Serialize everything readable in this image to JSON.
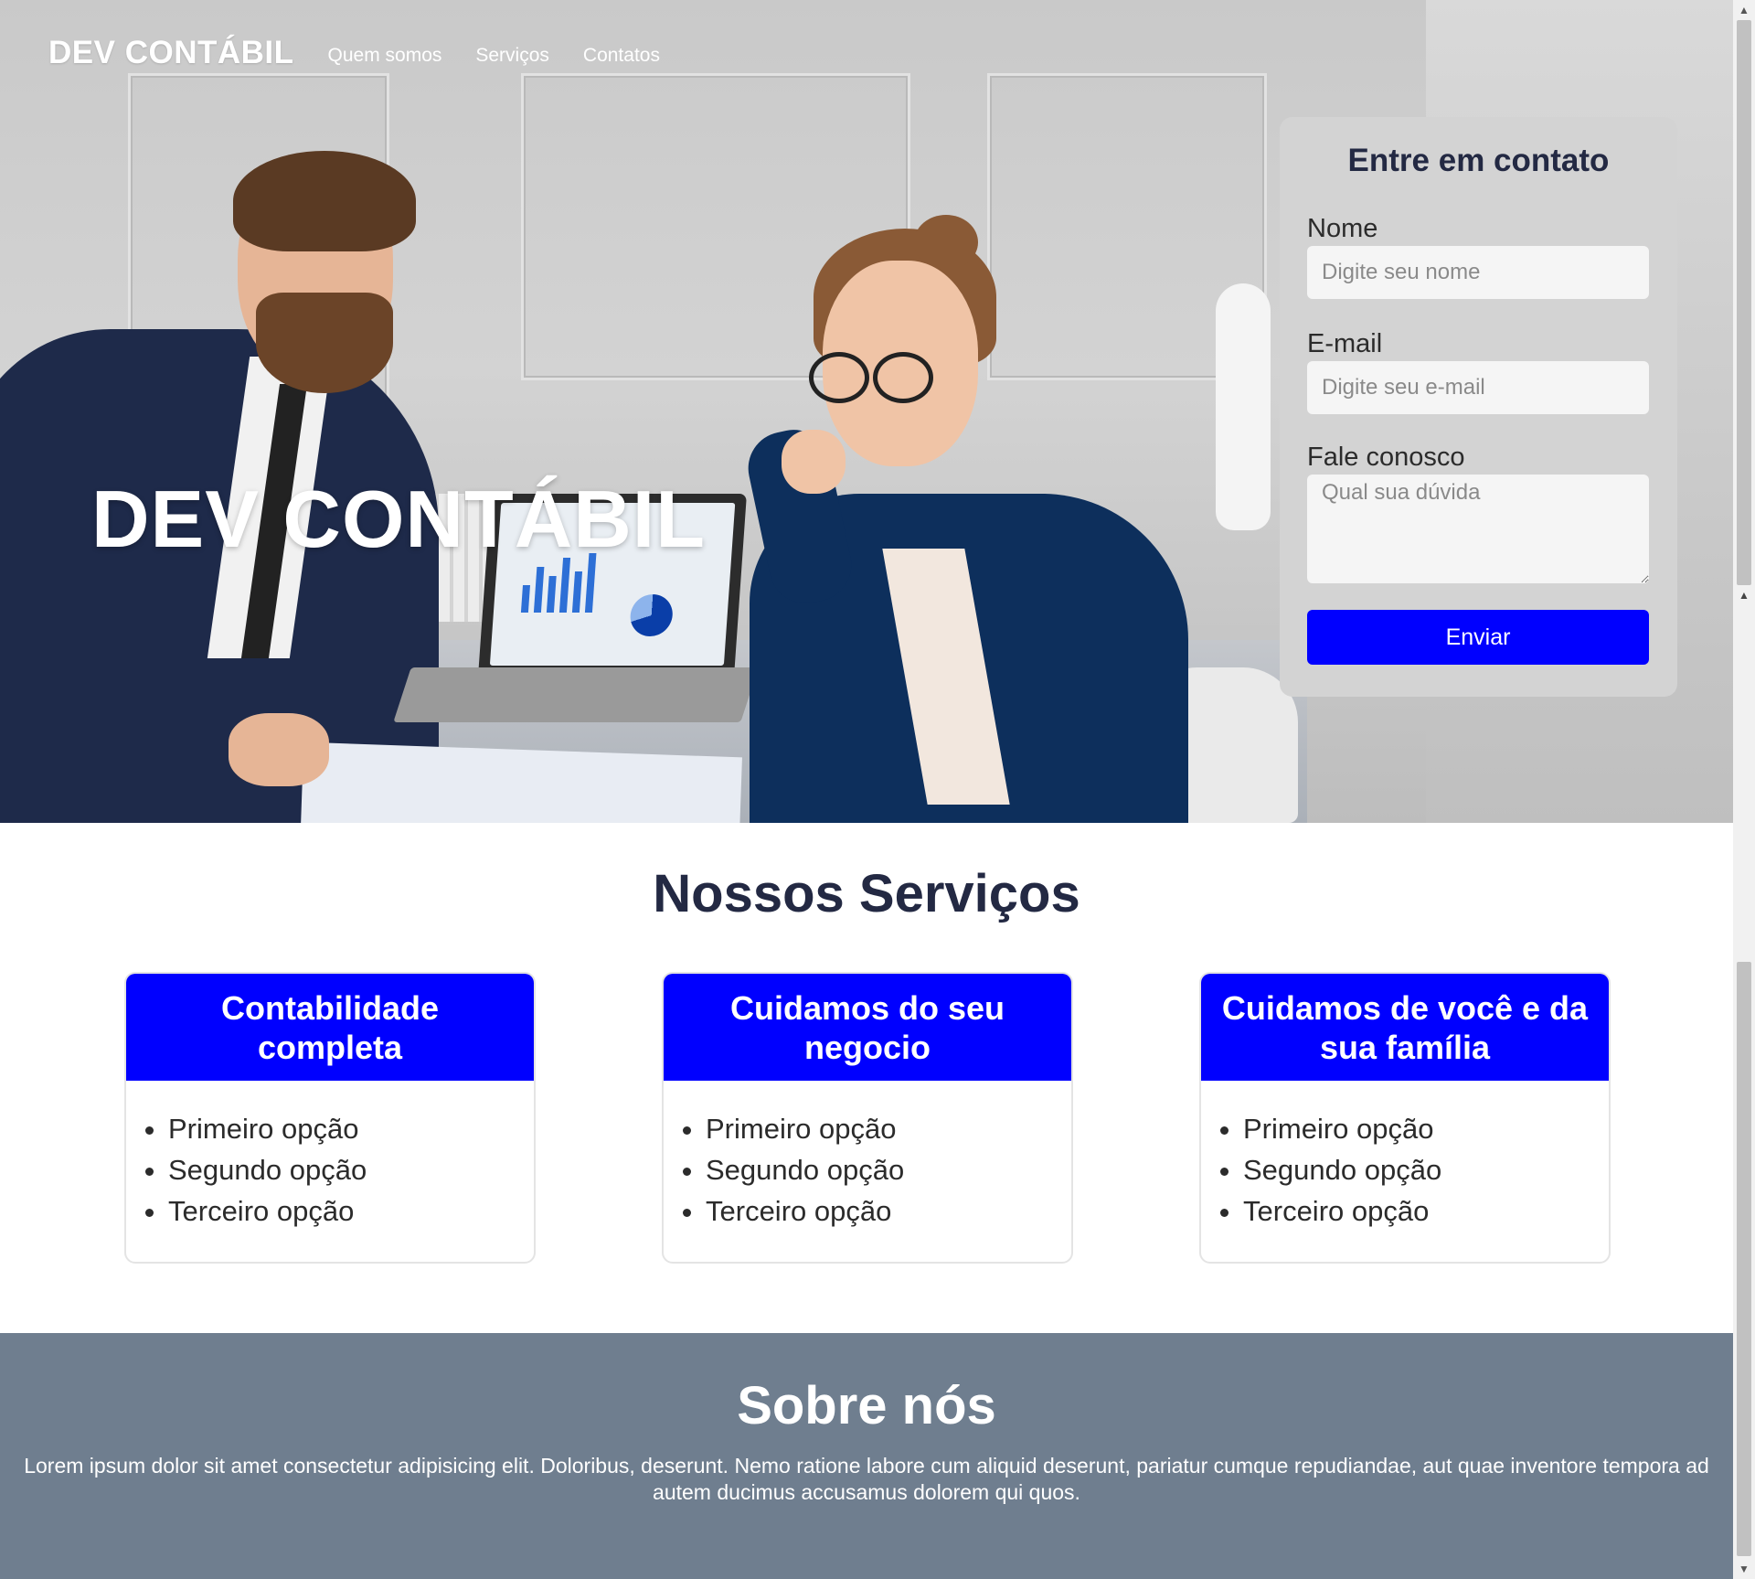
{
  "nav": {
    "brand": "DEV CONTÁBIL",
    "links": [
      "Quem somos",
      "Serviços",
      "Contatos"
    ]
  },
  "hero": {
    "title": "DEV CONTÁBIL"
  },
  "contact": {
    "title": "Entre em contato",
    "name_label": "Nome",
    "name_placeholder": "Digite seu nome",
    "email_label": "E-mail",
    "email_placeholder": "Digite seu e-mail",
    "message_label": "Fale conosco",
    "message_placeholder": "Qual sua dúvida",
    "submit_label": "Enviar"
  },
  "services": {
    "title": "Nossos Serviços",
    "cards": [
      {
        "title": "Contabilidade completa",
        "items": [
          "Primeiro opção",
          "Segundo opção",
          "Terceiro opção"
        ]
      },
      {
        "title": "Cuidamos do seu negocio",
        "items": [
          "Primeiro opção",
          "Segundo opção",
          "Terceiro opção"
        ]
      },
      {
        "title": "Cuidamos de você e da sua família",
        "items": [
          "Primeiro opção",
          "Segundo opção",
          "Terceiro opção"
        ]
      }
    ]
  },
  "about": {
    "title": "Sobre nós",
    "text": "Lorem ipsum dolor sit amet consectetur adipisicing elit. Doloribus, deserunt. Nemo ratione labore cum aliquid deserunt, pariatur cumque repudiandae, aut quae inventore tempora ad autem ducimus accusamus dolorem qui quos."
  },
  "colors": {
    "primary": "#0000ff",
    "heading": "#232943",
    "about_bg": "#6f7e8f",
    "form_bg": "#d3d3d3"
  }
}
